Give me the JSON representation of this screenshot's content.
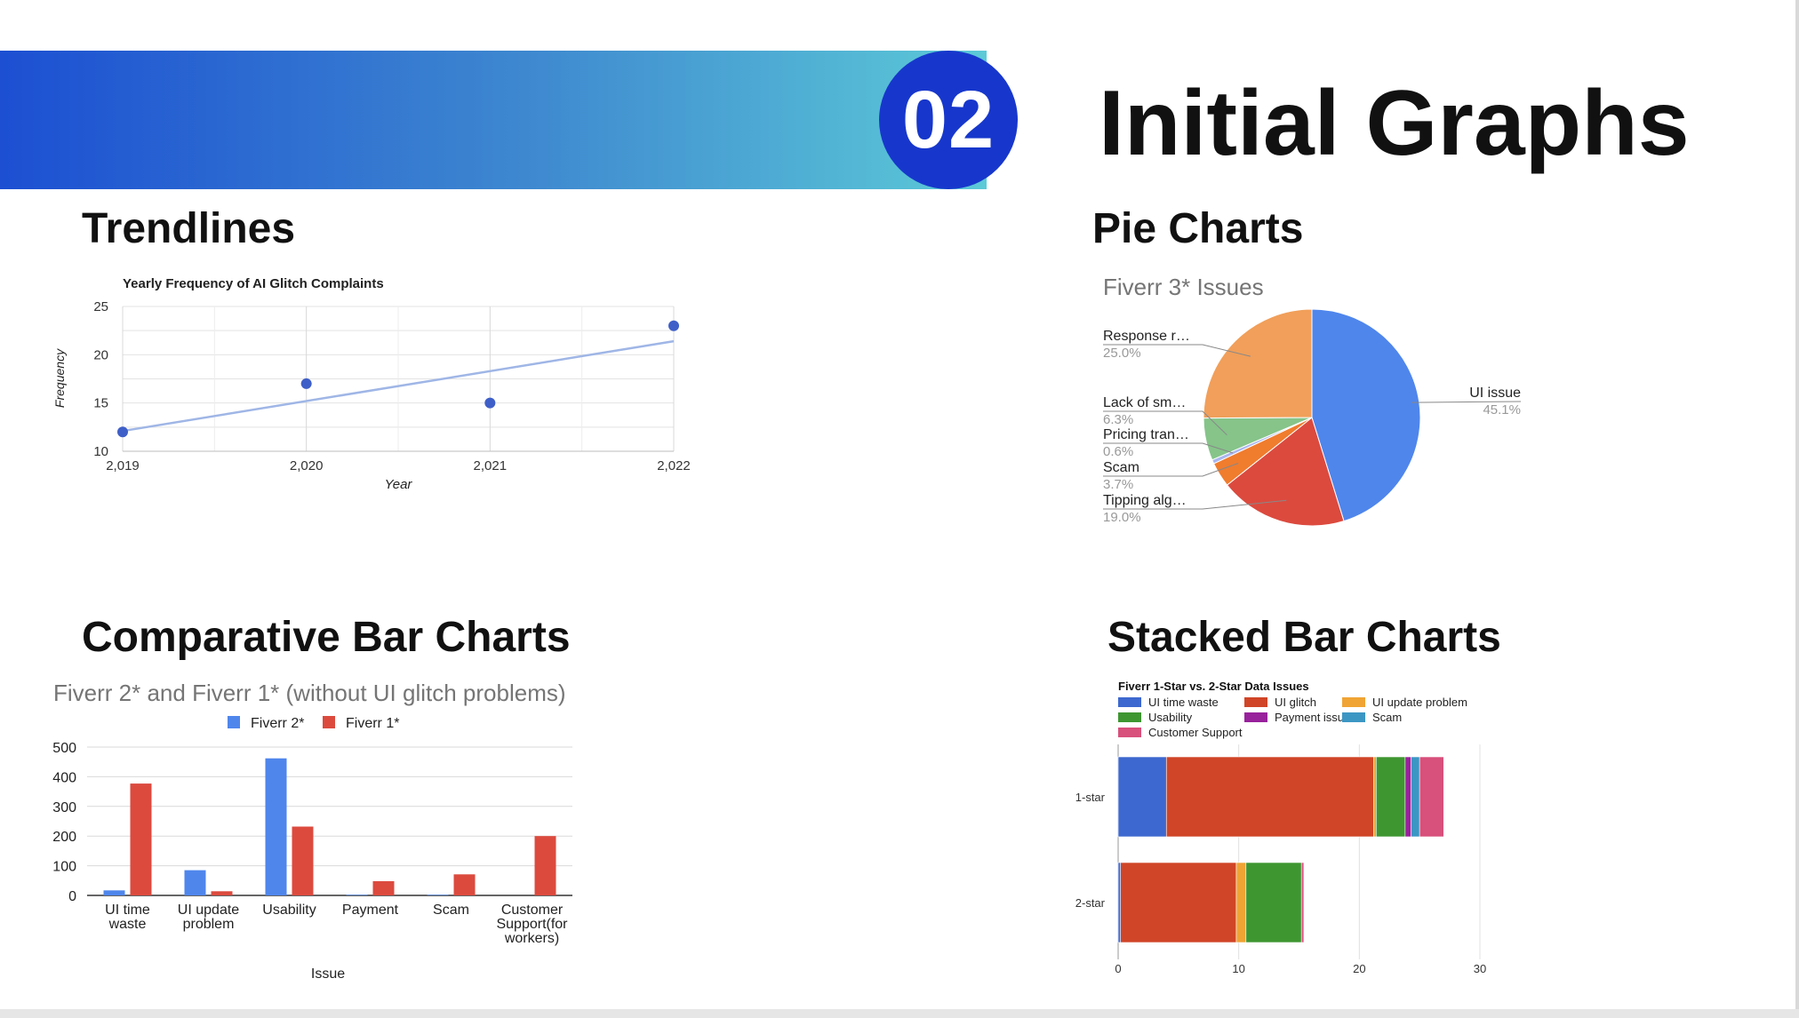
{
  "slide": {
    "number": "02",
    "title": "Initial Graphs",
    "sections": {
      "trendlines": "Trendlines",
      "pie": "Pie Charts",
      "comparative": "Comparative Bar Charts",
      "stacked": "Stacked Bar Charts"
    }
  },
  "colors": {
    "band_start": "#1c4fd2",
    "band_end": "#5ccad7",
    "circle": "#1737cc"
  },
  "chart_data": [
    {
      "id": "trend",
      "type": "scatter",
      "title": "Yearly Frequency of AI Glitch Complaints",
      "xlabel": "Year",
      "ylabel": "Frequency",
      "x": [
        2019,
        2020,
        2021,
        2022
      ],
      "y": [
        12,
        17,
        15,
        23
      ],
      "x_tick_labels": [
        "2,019",
        "2,020",
        "2,021",
        "2,022"
      ],
      "y_tick_labels": [
        "10",
        "15",
        "20",
        "25"
      ],
      "xlim": [
        2019,
        2022
      ],
      "ylim": [
        10,
        25
      ],
      "trendline": true,
      "grid": true,
      "point_color": "#3f5fc8",
      "trend_color": "#9fb6e6"
    },
    {
      "id": "pie",
      "type": "pie",
      "title": "Fiverr 3* Issues",
      "slices": [
        {
          "label": "UI issue",
          "pct_label": "45.1%",
          "value": 45.1,
          "color": "#4f86ec"
        },
        {
          "label": "Tipping alg…",
          "pct_label": "19.0%",
          "value": 19.0,
          "color": "#dc4a3e"
        },
        {
          "label": "Scam",
          "pct_label": "3.7%",
          "value": 3.7,
          "color": "#f07c2e"
        },
        {
          "label": "Pricing tran…",
          "pct_label": "0.6%",
          "value": 0.6,
          "color": "#a9b6f0"
        },
        {
          "label": "Lack of sm…",
          "pct_label": "6.3%",
          "value": 6.3,
          "color": "#86c48a"
        },
        {
          "label": "Response r…",
          "pct_label": "25.0%",
          "value": 25.0,
          "color": "#f19f5a"
        }
      ]
    },
    {
      "id": "comparative",
      "type": "bar",
      "title": "Fiverr 2* and Fiverr 1* (without UI glitch problems)",
      "xlabel": "Issue",
      "categories": [
        "UI time waste",
        "UI update problem",
        "Usability",
        "Payment",
        "Scam",
        "Customer Support(for workers)"
      ],
      "category_lines": [
        [
          "UI time",
          "waste"
        ],
        [
          "UI update",
          "problem"
        ],
        [
          "Usability"
        ],
        [
          "Payment"
        ],
        [
          "Scam"
        ],
        [
          "Customer",
          "Support(for",
          "workers)"
        ]
      ],
      "series": [
        {
          "name": "Fiverr 2*",
          "values": [
            17,
            85,
            462,
            2,
            2,
            0
          ],
          "color": "#4f86ec"
        },
        {
          "name": "Fiverr 1*",
          "values": [
            377,
            14,
            232,
            48,
            71,
            200
          ],
          "color": "#dc4a3e"
        }
      ],
      "ylim": [
        0,
        500
      ],
      "y_tick_labels": [
        "0",
        "100",
        "200",
        "300",
        "400",
        "500"
      ],
      "legend": "top"
    },
    {
      "id": "stacked",
      "type": "bar",
      "orientation": "horizontal",
      "stacked": true,
      "title": "Fiverr 1-Star vs. 2-Star Data Issues",
      "categories": [
        "1-star",
        "2-star"
      ],
      "series": [
        {
          "name": "UI time waste",
          "values": [
            4,
            0.2
          ],
          "color": "#3d68cf"
        },
        {
          "name": "UI glitch",
          "values": [
            17.2,
            9.6
          ],
          "color": "#d04527"
        },
        {
          "name": "UI update problem",
          "values": [
            0.2,
            0.8
          ],
          "color": "#f0a434"
        },
        {
          "name": "Usability",
          "values": [
            2.4,
            4.6
          ],
          "color": "#3e9631"
        },
        {
          "name": "Payment issues",
          "values": [
            0.5,
            0.0
          ],
          "color": "#98219c"
        },
        {
          "name": "Scam",
          "values": [
            0.7,
            0.0
          ],
          "color": "#3c96c4"
        },
        {
          "name": "Customer Support",
          "values": [
            2.0,
            0.2
          ],
          "color": "#d8507c"
        }
      ],
      "xlim": [
        0,
        30
      ],
      "x_tick_labels": [
        "0",
        "10",
        "20",
        "30"
      ],
      "legend": "top"
    }
  ]
}
